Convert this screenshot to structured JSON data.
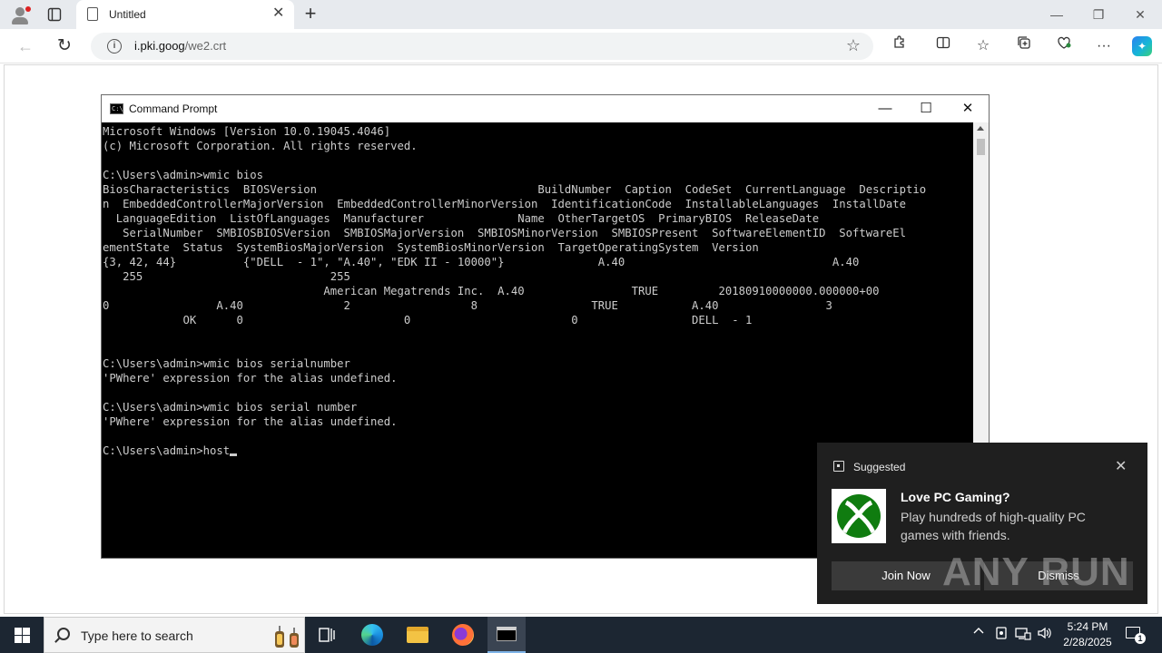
{
  "browser": {
    "tab_title": "Untitled",
    "url_host": "i.pki.goog",
    "url_path": "/we2.crt"
  },
  "cmd": {
    "title": "Command Prompt",
    "lines": [
      "Microsoft Windows [Version 10.0.19045.4046]",
      "(c) Microsoft Corporation. All rights reserved.",
      "",
      "C:\\Users\\admin>wmic bios",
      "BiosCharacteristics  BIOSVersion                                 BuildNumber  Caption  CodeSet  CurrentLanguage  Descriptio",
      "n  EmbeddedControllerMajorVersion  EmbeddedControllerMinorVersion  IdentificationCode  InstallableLanguages  InstallDate",
      "  LanguageEdition  ListOfLanguages  Manufacturer              Name  OtherTargetOS  PrimaryBIOS  ReleaseDate",
      "   SerialNumber  SMBIOSBIOSVersion  SMBIOSMajorVersion  SMBIOSMinorVersion  SMBIOSPresent  SoftwareElementID  SoftwareEl",
      "ementState  Status  SystemBiosMajorVersion  SystemBiosMinorVersion  TargetOperatingSystem  Version",
      "{3, 42, 44}          {\"DELL  - 1\", \"A.40\", \"EDK II - 10000\"}              A.40                               A.40",
      "   255                            255",
      "                                 American Megatrends Inc.  A.40                TRUE         20180910000000.000000+00",
      "0                A.40               2                  8                 TRUE           A.40                3",
      "            OK      0                        0                        0                 DELL  - 1",
      "",
      "",
      "C:\\Users\\admin>wmic bios serialnumber",
      "'PWhere' expression for the alias undefined.",
      "",
      "C:\\Users\\admin>wmic bios serial number",
      "'PWhere' expression for the alias undefined.",
      ""
    ],
    "prompt_line": "C:\\Users\\admin>host"
  },
  "toast": {
    "header": "Suggested",
    "title": "Love PC Gaming?",
    "body": "Play hundreds of high-quality PC games with friends.",
    "primary_label": "Join Now",
    "secondary_label": "Dismiss"
  },
  "watermark": "ANY RUN",
  "taskbar": {
    "search_placeholder": "Type here to search",
    "time": "5:24 PM",
    "date": "2/28/2025",
    "notification_count": "1"
  }
}
